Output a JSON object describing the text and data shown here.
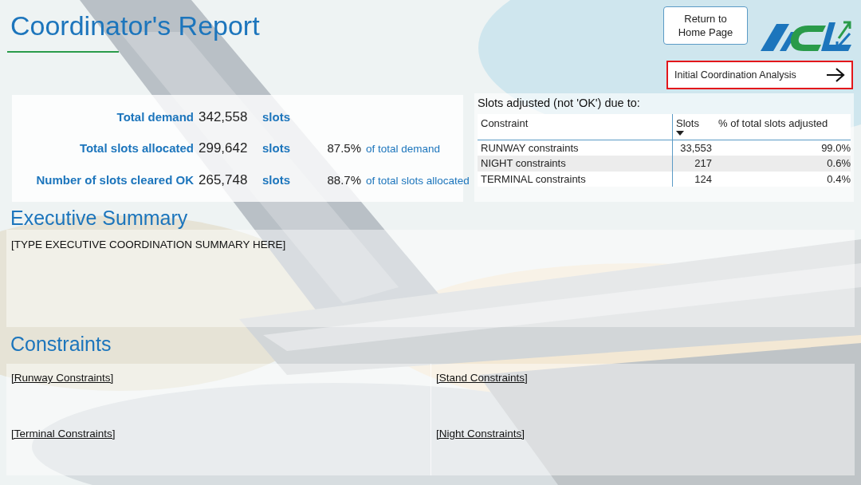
{
  "title": "Coordinator's Report",
  "header_buttons": [
    {
      "label": "Return to Home Page",
      "kind": "plain",
      "highlighted": false
    },
    {
      "label": "Initial Coordination Analysis",
      "kind": "arrow",
      "highlighted": true
    }
  ],
  "stats": [
    {
      "label": "Total demand",
      "value": "342,558",
      "unit": "slots"
    },
    {
      "label": "Total slots allocated",
      "value": "299,642",
      "unit": "slots",
      "percent": "87.5%",
      "of": "of total demand"
    },
    {
      "label": "Number of slots cleared OK",
      "value": "265,748",
      "unit": "slots",
      "percent": "88.7%",
      "of": "of total slots allocated"
    }
  ],
  "adjusted_table": {
    "title": "Slots adjusted (not 'OK') due to:",
    "columns": [
      {
        "label": "Constraint",
        "sorted": false
      },
      {
        "label": "Slots",
        "sorted": true
      },
      {
        "label": "% of total slots adjusted",
        "sorted": false
      }
    ],
    "rows": [
      [
        "RUNWAY constraints",
        "33,553",
        "99.0%"
      ],
      [
        "NIGHT constraints",
        "217",
        "0.6%"
      ],
      [
        "TERMINAL constraints",
        "124",
        "0.4%"
      ]
    ]
  },
  "executive_summary": {
    "heading": "Executive Summary",
    "text": "[TYPE EXECUTIVE COORDINATION SUMMARY HERE]"
  },
  "constraints": {
    "heading": "Constraints",
    "links": [
      "[Runway Constraints]",
      "[Stand Constraints]",
      "[Terminal Constraints]",
      "[Night Constraints]"
    ]
  }
}
